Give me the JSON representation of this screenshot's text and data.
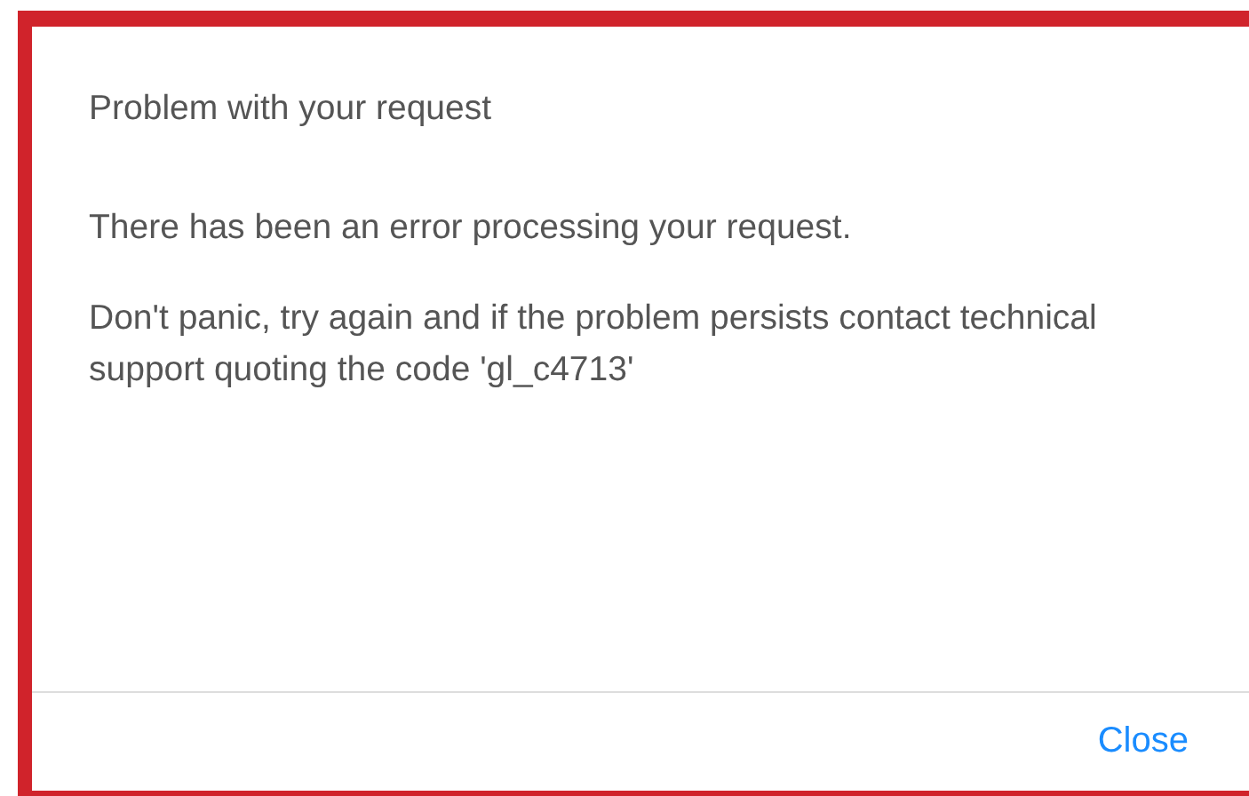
{
  "dialog": {
    "title": "Problem with your request",
    "paragraphs": [
      "There has been an error processing your request.",
      "Don't panic, try again and if the problem persists contact technical support quoting the code 'gl_c4713'"
    ],
    "buttons": [
      {
        "label": "Close"
      }
    ]
  }
}
